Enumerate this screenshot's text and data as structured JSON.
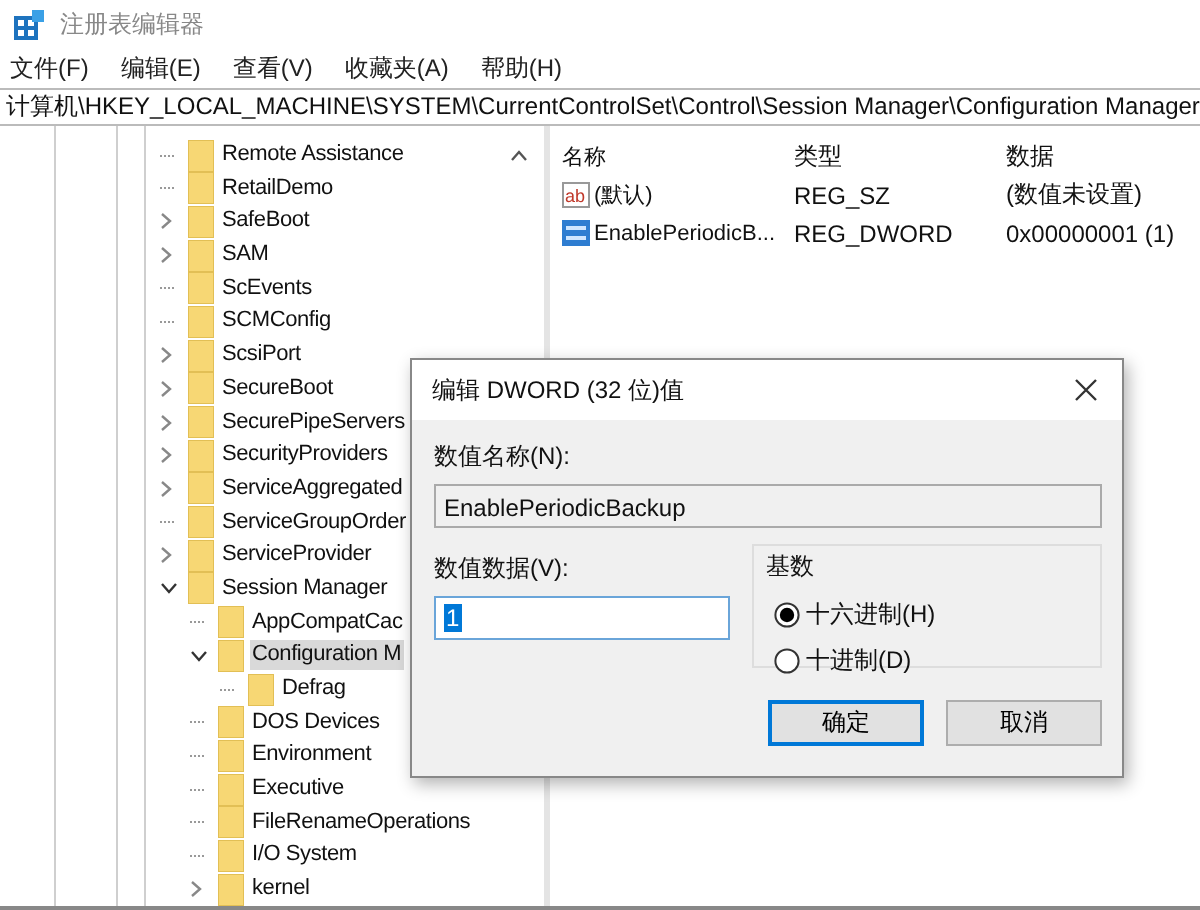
{
  "window": {
    "title": "注册表编辑器"
  },
  "menu": [
    "文件(F)",
    "编辑(E)",
    "查看(V)",
    "收藏夹(A)",
    "帮助(H)"
  ],
  "address": "计算机\\HKEY_LOCAL_MACHINE\\SYSTEM\\CurrentControlSet\\Control\\Session Manager\\Configuration Manager",
  "tree": [
    {
      "name": "Remote Assistance",
      "kind": "leaf",
      "selected": false
    },
    {
      "name": "RetailDemo",
      "kind": "leaf",
      "selected": false
    },
    {
      "name": "SafeBoot",
      "kind": "collapsed",
      "selected": false
    },
    {
      "name": "SAM",
      "kind": "collapsed",
      "selected": false
    },
    {
      "name": "ScEvents",
      "kind": "leaf",
      "selected": false
    },
    {
      "name": "SCMConfig",
      "kind": "leaf",
      "selected": false
    },
    {
      "name": "ScsiPort",
      "kind": "collapsed",
      "selected": false
    },
    {
      "name": "SecureBoot",
      "kind": "collapsed",
      "selected": false
    },
    {
      "name": "SecurePipeServers",
      "kind": "collapsed",
      "selected": false
    },
    {
      "name": "SecurityProviders",
      "kind": "collapsed",
      "selected": false
    },
    {
      "name": "ServiceAggregated",
      "kind": "collapsed",
      "selected": false
    },
    {
      "name": "ServiceGroupOrder",
      "kind": "leaf",
      "selected": false
    },
    {
      "name": "ServiceProvider",
      "kind": "collapsed",
      "selected": false
    },
    {
      "name": "Session Manager",
      "kind": "expanded",
      "selected": false,
      "children": [
        {
          "name": "AppCompatCac",
          "kind": "leaf",
          "selected": false
        },
        {
          "name": "Configuration M",
          "kind": "expanded",
          "selected": true,
          "children": [
            {
              "name": "Defrag",
              "kind": "leaf",
              "selected": false
            }
          ]
        },
        {
          "name": "DOS Devices",
          "kind": "leaf",
          "selected": false
        },
        {
          "name": "Environment",
          "kind": "leaf",
          "selected": false
        },
        {
          "name": "Executive",
          "kind": "leaf",
          "selected": false
        },
        {
          "name": "FileRenameOperations",
          "kind": "leaf",
          "selected": false
        },
        {
          "name": "I/O System",
          "kind": "leaf",
          "selected": false
        },
        {
          "name": "kernel",
          "kind": "collapsed",
          "selected": false
        }
      ]
    }
  ],
  "list": {
    "columns": [
      "名称",
      "类型",
      "数据"
    ],
    "rows": [
      {
        "kind": "string",
        "icon_label": "ab",
        "name": "(默认)",
        "type": "REG_SZ",
        "data": "(数值未设置)"
      },
      {
        "kind": "binary",
        "name": "EnablePeriodicB...",
        "type": "REG_DWORD",
        "data": "0x00000001 (1)"
      }
    ]
  },
  "dialog": {
    "title": "编辑 DWORD (32 位)值",
    "name_label": "数值名称(N):",
    "name_value": "EnablePeriodicBackup",
    "data_label": "数值数据(V):",
    "data_value": "1",
    "data_value_selected": true,
    "base_label": "基数",
    "radios": [
      {
        "label": "十六进制(H)",
        "selected": true
      },
      {
        "label": "十进制(D)",
        "selected": false
      }
    ],
    "buttons": [
      {
        "label": "确定",
        "default": true
      },
      {
        "label": "取消",
        "default": false
      }
    ]
  }
}
